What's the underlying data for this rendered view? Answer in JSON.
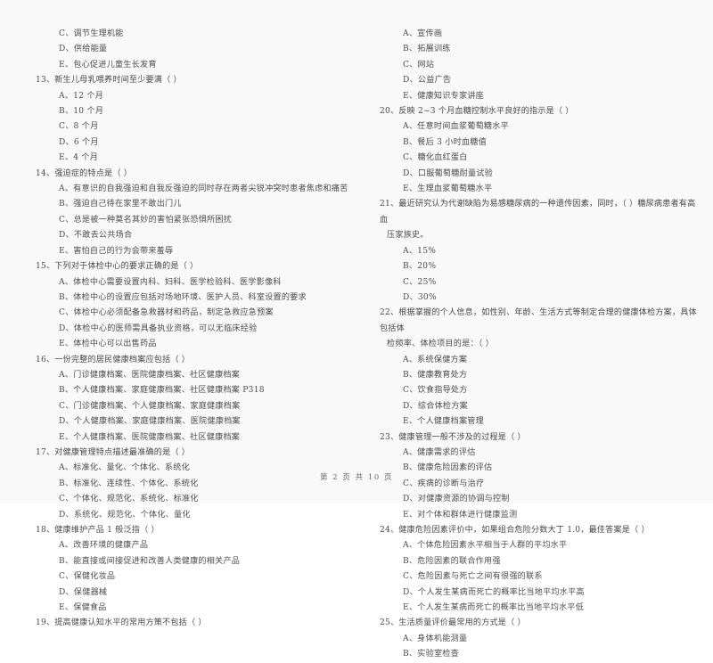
{
  "document": {
    "type": "exam-paper-scan",
    "footer": "第 2 页 共 10 页"
  },
  "left_column": {
    "blocks": [
      {
        "kind": "option",
        "text": "C、调节生理机能"
      },
      {
        "kind": "option",
        "text": "D、供给能量"
      },
      {
        "kind": "option",
        "text": "E、包心促进儿童生长发育"
      },
      {
        "kind": "stem",
        "text": "13、新生儿母乳喂养时间至少要满（     ）"
      },
      {
        "kind": "option",
        "text": "A、12 个月"
      },
      {
        "kind": "option",
        "text": "B、10 个月"
      },
      {
        "kind": "option",
        "text": "C、8 个月"
      },
      {
        "kind": "option",
        "text": "D、6 个月"
      },
      {
        "kind": "option",
        "text": "E、4 个月"
      },
      {
        "kind": "stem",
        "text": "14、强迫症的特点是（     ）"
      },
      {
        "kind": "option",
        "text": "A、有意识的自我强迫和自我反强迫的同时存在两者尖锐冲突时患者焦虑和痛苦"
      },
      {
        "kind": "option",
        "text": "B、强迫自己待在家里不敢出门儿"
      },
      {
        "kind": "option",
        "text": "C、总是被一种莫名其妙的害怕紧张恐惧所困扰"
      },
      {
        "kind": "option",
        "text": "D、不敢去公共场合"
      },
      {
        "kind": "option",
        "text": "E、害怕自己的行为会带来羞辱"
      },
      {
        "kind": "stem",
        "text": "15、下列对于体检中心的要求正确的是（     ）"
      },
      {
        "kind": "option",
        "text": "A、体检中心需要设置内科、妇科、医学检验科、医学影像科"
      },
      {
        "kind": "option",
        "text": "B、体检中心的设置应包括对场地环境、医护人员、科室设置的要求"
      },
      {
        "kind": "option",
        "text": "C、体检中心必须配备急救器材和药品，制定急救应急预案"
      },
      {
        "kind": "option",
        "text": "D、体检中心的医师需具备执业资格，可以无临床经验"
      },
      {
        "kind": "option",
        "text": "E、体检中心可以出售药品"
      },
      {
        "kind": "stem",
        "text": "16、一份完整的居民健康档案应包括（     ）"
      },
      {
        "kind": "option",
        "text": "A、门诊健康档案、医院健康档案、社区健康档案"
      },
      {
        "kind": "option",
        "text": "B、个人健康档案、家庭健康档案、社区健康档案 P318"
      },
      {
        "kind": "option",
        "text": "C、门诊健康档案、个人健康档案、家庭健康档案"
      },
      {
        "kind": "option",
        "text": "D、个人健康档案、家庭健康档案、医院健康档案"
      },
      {
        "kind": "option",
        "text": "E、个人健康档案、医院健康档案、社区健康档案"
      },
      {
        "kind": "stem",
        "text": "17、对健康管理特点描述最准确的是（     ）"
      },
      {
        "kind": "option",
        "text": "A、标准化、量化、个体化、系统化"
      },
      {
        "kind": "option",
        "text": "B、标准化、连续性、个体化、系统化"
      },
      {
        "kind": "option",
        "text": "C、个体化、规范化、系统化、标准化"
      },
      {
        "kind": "option",
        "text": "D、系统化、规范化、个体化、量化"
      },
      {
        "kind": "stem",
        "text": "18、健康维护产品 1 般泛指（     ）"
      },
      {
        "kind": "option",
        "text": "A、改善环境的健康产品"
      },
      {
        "kind": "option",
        "text": "B、能直接或间接促进和改善人类健康的相关产品"
      },
      {
        "kind": "option",
        "text": "C、保健化妆品"
      },
      {
        "kind": "option",
        "text": "D、保健器械"
      },
      {
        "kind": "option",
        "text": "E、保健食品"
      },
      {
        "kind": "stem",
        "text": "19、提高健康认知水平的常用方策不包括（     ）"
      }
    ]
  },
  "right_column": {
    "blocks": [
      {
        "kind": "option",
        "text": "A、宣传画"
      },
      {
        "kind": "option",
        "text": "B、拓展训练"
      },
      {
        "kind": "option",
        "text": "C、网站"
      },
      {
        "kind": "option",
        "text": "D、公益广告"
      },
      {
        "kind": "option",
        "text": "E、健康知识专家讲座"
      },
      {
        "kind": "stem",
        "text": "20、反映 2~3 个月血糖控制水平良好的指示是（     ）"
      },
      {
        "kind": "option",
        "text": "A、任意时间血浆葡萄糖水平"
      },
      {
        "kind": "option",
        "text": "B、餐后 3 小时血糖值"
      },
      {
        "kind": "option",
        "text": "C、糖化血红蛋白"
      },
      {
        "kind": "option",
        "text": "D、口服葡萄糖耐量试验"
      },
      {
        "kind": "option",
        "text": "E、生理血浆葡萄糖水平"
      },
      {
        "kind": "stem",
        "text": "21、最近研究认为代谢缺陷为易感糖尿病的一种遗传因素，同时，（     ）糖尿病患者有高血"
      },
      {
        "kind": "cont",
        "text": "压家族史。"
      },
      {
        "kind": "option",
        "text": "A、15%"
      },
      {
        "kind": "option",
        "text": "B、20%"
      },
      {
        "kind": "option",
        "text": "C、25%"
      },
      {
        "kind": "option",
        "text": "D、30%"
      },
      {
        "kind": "stem",
        "text": "22、根据掌握的个人信息，如性别、年龄、生活方式等制定合理的健康体检方案，具体包括体"
      },
      {
        "kind": "cont",
        "text": "检频率、体检项目的是：（     ）"
      },
      {
        "kind": "option",
        "text": "A、系统保健方案"
      },
      {
        "kind": "option",
        "text": "B、健康教育处方"
      },
      {
        "kind": "option",
        "text": "C、饮食指导处方"
      },
      {
        "kind": "option",
        "text": "D、综合体检方案"
      },
      {
        "kind": "option",
        "text": "E、个人健康档案管理"
      },
      {
        "kind": "stem",
        "text": "23、健康管理一般不涉及的过程是（     ）"
      },
      {
        "kind": "option",
        "text": "A、健康需求的评估"
      },
      {
        "kind": "option",
        "text": "B、健康危险因素的评估"
      },
      {
        "kind": "option",
        "text": "C、疾病的诊断与治疗"
      },
      {
        "kind": "option",
        "text": "D、对健康资源的协调与控制"
      },
      {
        "kind": "option",
        "text": "E、对个体和群体进行健康监测"
      },
      {
        "kind": "stem",
        "text": "24、健康危险因素评价中，如果组合危险分数大丁 1.0，最佳答案是（     ）"
      },
      {
        "kind": "option",
        "text": "A、个体危险因素水平相当于人群的平均水平"
      },
      {
        "kind": "option",
        "text": "B、危险因素的联合作用强"
      },
      {
        "kind": "option",
        "text": "C、危险因素与死亡之间有很强的联系"
      },
      {
        "kind": "option",
        "text": "D、个人发生某病而死亡的概率比当地平均水平高"
      },
      {
        "kind": "option",
        "text": "E、个人发生某病而死亡的概率比当地平均水平低"
      },
      {
        "kind": "stem",
        "text": "25、生活质量评价最常用的方式是（     ）"
      },
      {
        "kind": "option",
        "text": "A、身体机能测量"
      },
      {
        "kind": "option",
        "text": "B、实验室检查"
      }
    ]
  }
}
